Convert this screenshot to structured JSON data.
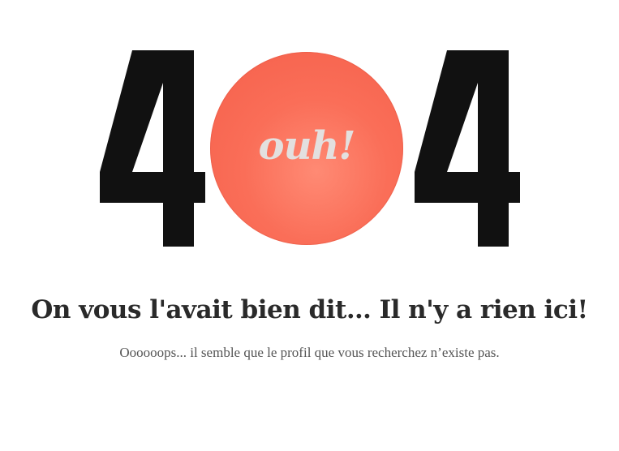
{
  "error": {
    "digit_left": "4",
    "digit_right": "4",
    "circle_text": "ouh!",
    "circle_color": "#f76a55",
    "digit_color": "#111111"
  },
  "message": {
    "headline": "On vous l'avait bien dit… Il n'y a rien ici!",
    "subtext": "Oooooops... il semble que le profil que vous recherchez n’existe pas."
  }
}
